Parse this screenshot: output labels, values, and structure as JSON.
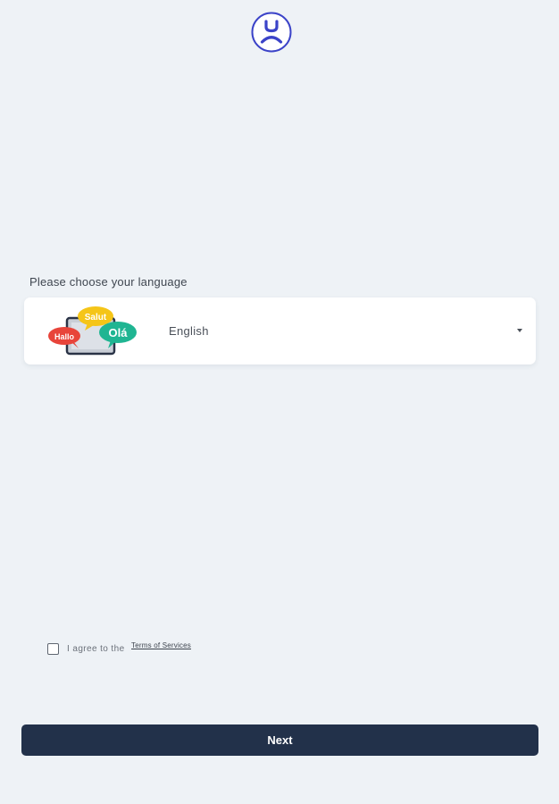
{
  "logo": {
    "icon": "app-logo-face-icon",
    "color": "#3b43c8"
  },
  "language": {
    "label": "Please choose your language",
    "selected": "English",
    "illustration": {
      "icon": "language-speech-bubbles-icon",
      "bubbles": [
        {
          "text": "Salut",
          "color": "#f5c518"
        },
        {
          "text": "Hallo",
          "color": "#e8443a"
        },
        {
          "text": "Olá",
          "color": "#1fb592"
        }
      ]
    },
    "dropdown_icon": "chevron-down-icon"
  },
  "terms": {
    "prefix": "I agree to the",
    "link": "Terms of Services"
  },
  "next_button": {
    "label": "Next",
    "color": "#22314a"
  },
  "colors": {
    "background": "#eef2f6",
    "card": "#ffffff"
  }
}
